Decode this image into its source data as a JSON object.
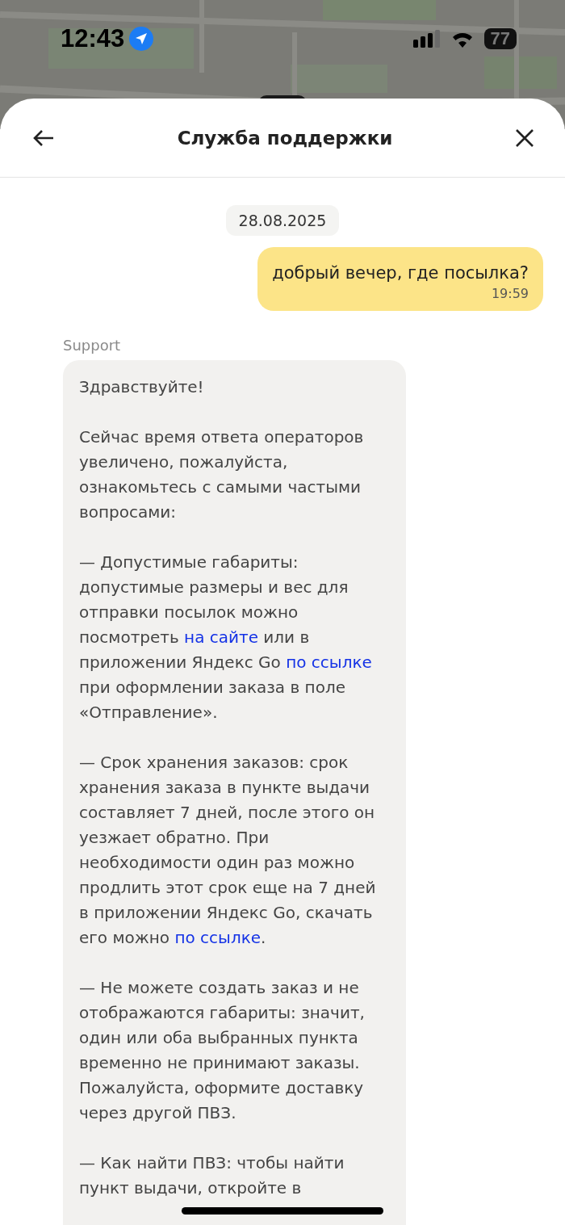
{
  "status_bar": {
    "time": "12:43",
    "battery": "77"
  },
  "header": {
    "title": "Служба поддержки"
  },
  "chat": {
    "date": "28.08.2025",
    "messages": [
      {
        "kind": "outgoing",
        "text": "добрый вечер, где посылка?",
        "time": "19:59"
      },
      {
        "kind": "incoming",
        "sender": "Support",
        "paragraphs": [
          [
            {
              "text": "Здравствуйте!",
              "link": false
            }
          ],
          [
            {
              "text": "Сейчас время ответа операторов увеличено, пожалуйста, ознакомьтесь с самыми частыми вопросами:",
              "link": false
            }
          ],
          [
            {
              "text": "— Допустимые габариты: допустимые размеры и вес для отправки посылок можно посмотреть ",
              "link": false
            },
            {
              "text": "на сайте",
              "link": true
            },
            {
              "text": " или в приложении Яндекс Go ",
              "link": false
            },
            {
              "text": "по ссылке",
              "link": true
            },
            {
              "text": " при оформлении заказа в поле «Отправление».",
              "link": false
            }
          ],
          [
            {
              "text": "— Срок хранения заказов: срок хранения заказа в пункте выдачи составляет 7 дней, после этого он уезжает обратно. При необходимости один раз можно продлить этот срок еще на 7 дней в приложении Яндекс Go, скачать его можно ",
              "link": false
            },
            {
              "text": "по ссылке",
              "link": true
            },
            {
              "text": ".",
              "link": false
            }
          ],
          [
            {
              "text": "— Не можете создать заказ и не отображаются габариты: значит, один или оба выбранных пункта временно не принимают заказы. Пожалуйста, оформите доставку через другой ПВЗ.",
              "link": false
            }
          ],
          [
            {
              "text": "— Как найти ПВЗ: чтобы найти пункт выдачи, откройте в",
              "link": false
            }
          ]
        ]
      }
    ]
  }
}
